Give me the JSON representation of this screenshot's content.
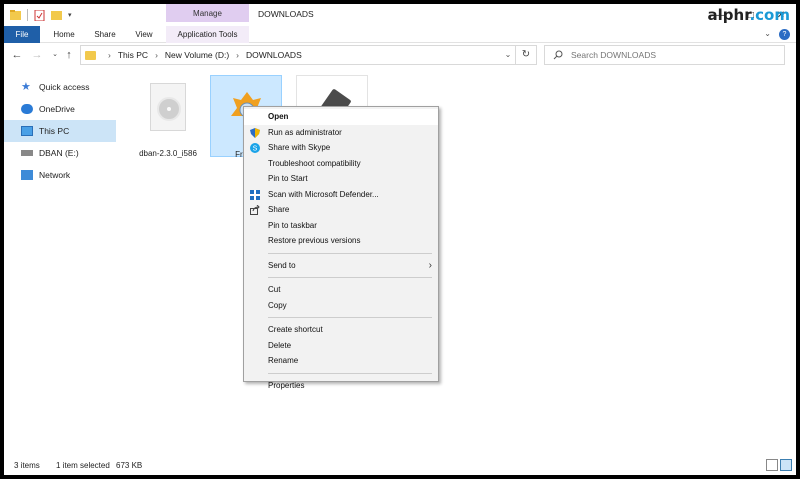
{
  "window": {
    "title": "DOWNLOADS",
    "contextual_tab": "Manage"
  },
  "ribbon": {
    "tabs": [
      "File",
      "Home",
      "Share",
      "View",
      "Application Tools"
    ]
  },
  "nav": {
    "breadcrumb": [
      "This PC",
      "New Volume (D:)",
      "DOWNLOADS"
    ],
    "search_placeholder": "Search DOWNLOADS"
  },
  "sidebar": {
    "items": [
      {
        "label": "Quick access",
        "icon": "star-icon"
      },
      {
        "label": "OneDrive",
        "icon": "cloud-icon"
      },
      {
        "label": "This PC",
        "icon": "computer-icon",
        "selected": true
      },
      {
        "label": "DBAN (E:)",
        "icon": "drive-icon"
      },
      {
        "label": "Network",
        "icon": "network-icon"
      }
    ]
  },
  "files": [
    {
      "name": "dban-2.3.0_i586",
      "icon": "disc-image-icon"
    },
    {
      "name": "FreeS",
      "icon": "app-icon",
      "selected": true
    },
    {
      "name": "",
      "icon": "usb-drive-icon"
    }
  ],
  "context_menu": {
    "groups": [
      [
        {
          "label": "Open",
          "bold": true
        },
        {
          "label": "Run as administrator",
          "icon": "shield-icon"
        },
        {
          "label": "Share with Skype",
          "icon": "skype-icon"
        },
        {
          "label": "Troubleshoot compatibility"
        },
        {
          "label": "Pin to Start"
        },
        {
          "label": "Scan with Microsoft Defender...",
          "icon": "defender-icon"
        },
        {
          "label": "Share",
          "icon": "share-icon"
        },
        {
          "label": "Pin to taskbar"
        },
        {
          "label": "Restore previous versions"
        }
      ],
      [
        {
          "label": "Send to",
          "submenu": true
        }
      ],
      [
        {
          "label": "Cut"
        },
        {
          "label": "Copy"
        }
      ],
      [
        {
          "label": "Create shortcut"
        },
        {
          "label": "Delete"
        },
        {
          "label": "Rename"
        }
      ],
      [
        {
          "label": "Properties"
        }
      ]
    ]
  },
  "status": {
    "items": "3 items",
    "selection": "1 item selected",
    "size": "673 KB"
  },
  "watermark": {
    "left": "alphr",
    "right": ".com"
  },
  "colors": {
    "file_tab": "#1f5fa8",
    "manage_tab": "#e0cdf0",
    "selection": "#cce8ff",
    "menu_bg": "#f2f2f2"
  }
}
